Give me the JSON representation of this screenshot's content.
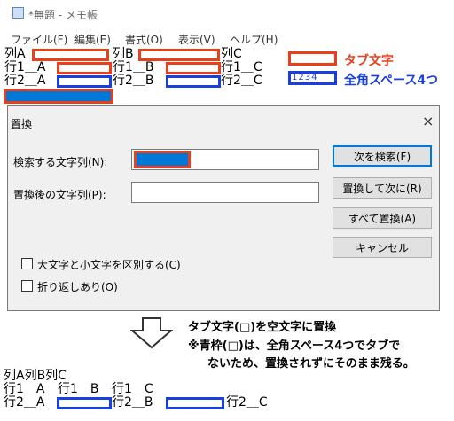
{
  "window": {
    "title": "*無題 - メモ帳"
  },
  "menu": [
    "ファイル(F)",
    "編集(E)",
    "書式(O)",
    "表示(V)",
    "ヘルプ(H)"
  ],
  "editor_lines": {
    "row1": [
      "列A",
      "列B",
      "列C"
    ],
    "row2": [
      "行1＿A",
      "行1＿B",
      "行1＿C"
    ],
    "row3": [
      "行2＿A",
      "行2＿B",
      "行2＿C"
    ]
  },
  "legend": {
    "tab_label": "タブ文字",
    "space_label": "全角スペース4つ",
    "space_digits": "1234"
  },
  "dialog": {
    "title": "置換",
    "close": "×",
    "find_label": "検索する文字列(N):",
    "replace_label": "置換後の文字列(P):",
    "find_next": "次を検索(F)",
    "replace_next": "置換して次に(R)",
    "replace_all": "すべて置換(A)",
    "cancel": "キャンセル",
    "match_case": "大文字と小文字を区別する(C)",
    "wrap": "折り返しあり(O)"
  },
  "explanation": {
    "line1": "タブ文字(□)を空文字に置換",
    "line2": "※青枠(□)は、全角スペース4つでタブで",
    "line3": "ないため、置換されずにそのまま残る。"
  },
  "result_lines": {
    "row1": "列A列B列C",
    "row2": [
      "行1＿A",
      "行1＿B",
      "行1＿C"
    ],
    "row3": [
      "行2＿A",
      "行2＿B",
      "行2＿C"
    ]
  },
  "colors": {
    "tab": "#e8401c",
    "space": "#1a3fe0",
    "selection": "#0078d7"
  }
}
